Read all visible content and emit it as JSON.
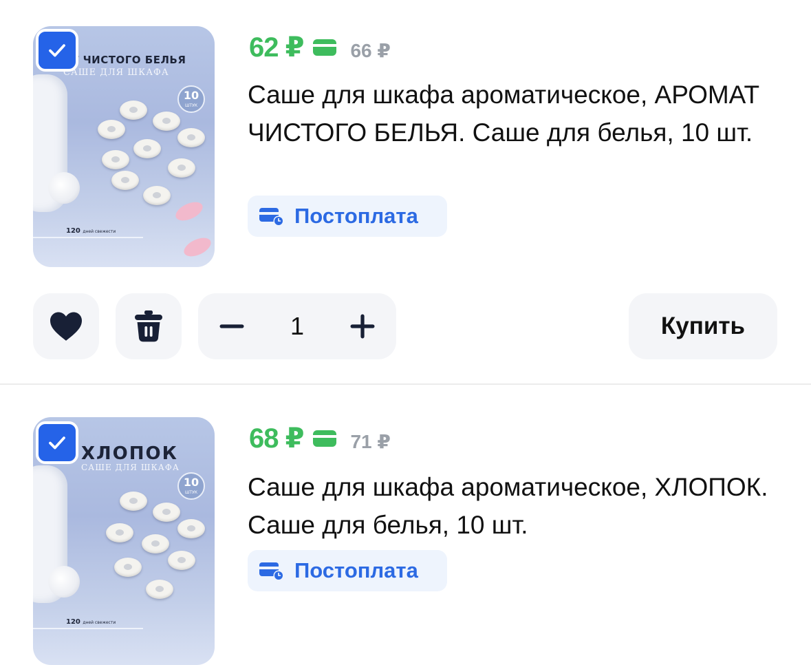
{
  "items": [
    {
      "price": "62 ₽",
      "old_price": "66 ₽",
      "title": "Саше для шкафа ароматическое, АРОМАТ ЧИСТОГО БЕЛЬЯ. Саше для белья, 10 шт.",
      "payment_badge": "Постоплата",
      "checked": true,
      "image": {
        "title": "АТ ЧИСТОГО БЕЛЬЯ",
        "subtitle": "САШЕ ДЛЯ ШКАФА",
        "badge_number": "10",
        "badge_unit": "ШТУК",
        "footer_number": "120",
        "footer_text": "дней свежести"
      }
    },
    {
      "price": "68 ₽",
      "old_price": "71 ₽",
      "title": "Саше для шкафа ароматическое, ХЛОПОК. Саше для белья, 10 шт.",
      "payment_badge": "Постоплата",
      "checked": true,
      "image": {
        "title": "ХЛОПОК",
        "subtitle": "САШЕ ДЛЯ ШКАФА",
        "badge_number": "10",
        "badge_unit": "ШТУК",
        "footer_number": "120",
        "footer_text": "дней свежести"
      }
    }
  ],
  "actions": {
    "quantity": "1",
    "buy_label": "Купить"
  },
  "icons": {
    "favorite": "heart-icon",
    "delete": "trash-icon",
    "decrement": "minus-icon",
    "increment": "plus-icon",
    "checkbox": "check-icon",
    "wallet": "card-icon",
    "postpay": "card-clock-icon"
  },
  "colors": {
    "price_green": "#3ebc5d",
    "old_price_gray": "#9aa0a8",
    "accent_blue": "#2563e8",
    "postpay_text": "#2c6ae3",
    "postpay_bg": "#eef4fd",
    "button_bg": "#f4f5f8"
  }
}
